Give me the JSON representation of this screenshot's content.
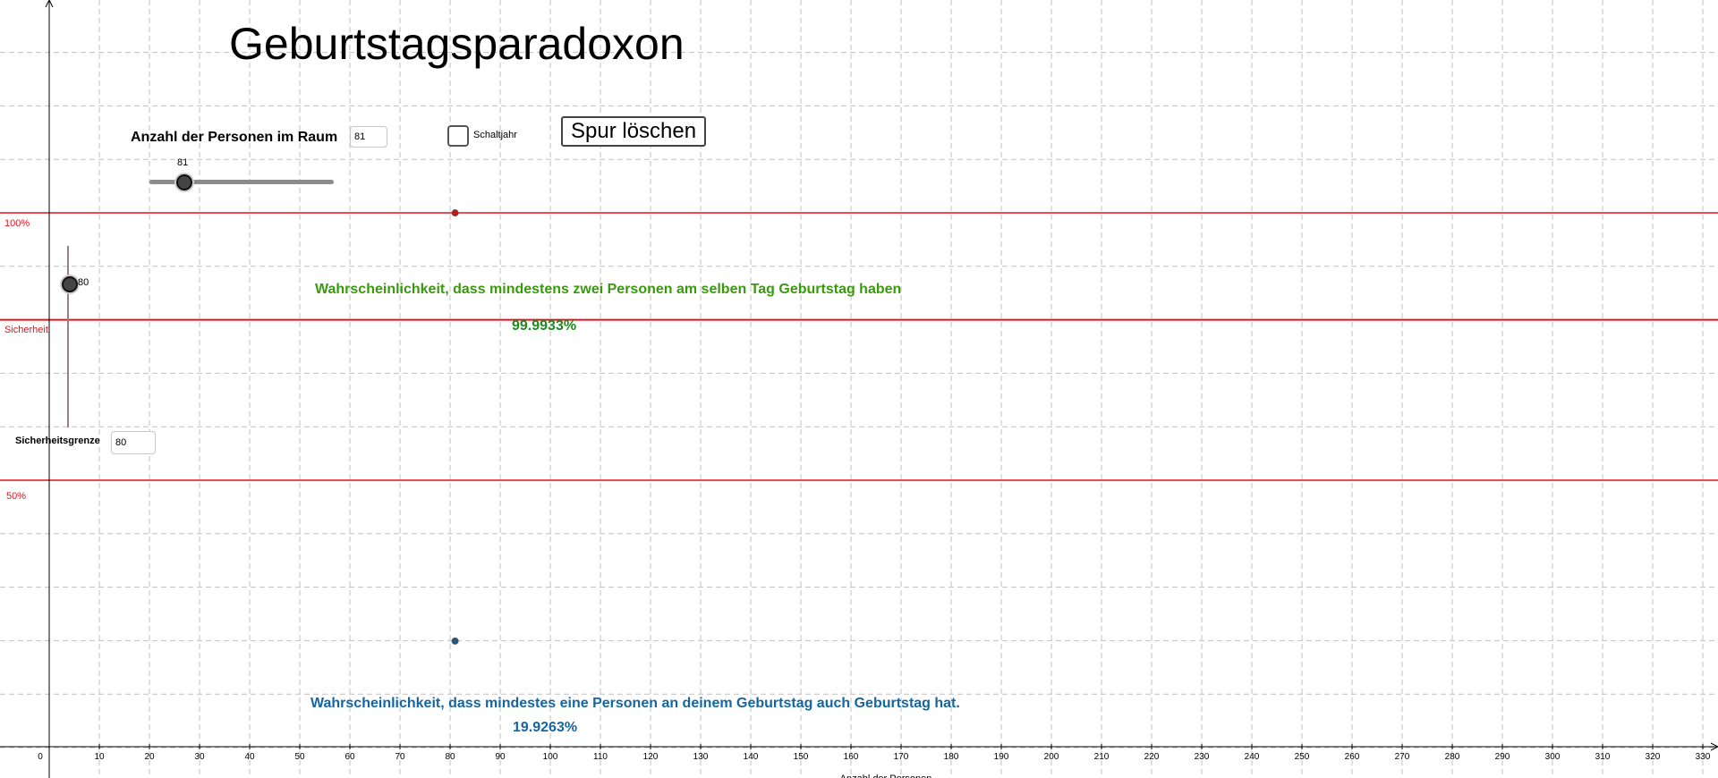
{
  "title": "Geburtstagsparadoxon",
  "persons": {
    "label": "Anzahl der Personen im Raum",
    "input_value": "81",
    "slider_value": "81",
    "slider_min": 0,
    "slider_max": 100,
    "slider_level": 81
  },
  "leap_year": {
    "label": "Schaltjahr",
    "checked": false
  },
  "clear_trace_button": "Spur löschen",
  "levels": {
    "hundred_label": "100%",
    "safety_label": "Sicherheit",
    "fifty_label": "50%"
  },
  "safety_slider": {
    "value": "80",
    "level": 80
  },
  "safety_limit": {
    "label": "Sicherheitsgrenze",
    "input_value": "80"
  },
  "prob_same_day": {
    "text": "Wahrscheinlichkeit, dass mindestens zwei Personen am selben Tag Geburtstag haben",
    "value": "99.9933%"
  },
  "prob_your_birthday": {
    "text": "Wahrscheinlichkeit, dass mindestes eine Personen an deinem Geburtstag auch Geburtstag hat.",
    "value": "19.9263%"
  },
  "axis": {
    "xlabel": "Anzahl der Personen",
    "ticks": [
      "0",
      "10",
      "20",
      "30",
      "40",
      "50",
      "60",
      "70",
      "80",
      "90",
      "100",
      "110",
      "120",
      "130",
      "140",
      "150",
      "160",
      "170",
      "180",
      "190",
      "200",
      "210",
      "220",
      "230",
      "240",
      "250",
      "260",
      "270",
      "280",
      "290",
      "300",
      "310",
      "320",
      "330"
    ]
  },
  "points": {
    "same_day": {
      "x": 81,
      "y": 99.9933
    },
    "your_birthday": {
      "x": 81,
      "y": 19.9263
    }
  },
  "colors": {
    "grid": "#c0c0c0",
    "red_line": "#e0141e",
    "green": "#3a9a0e",
    "blue": "#1566a0",
    "point_red": "#cc1111",
    "point_blue": "#1a5a8a"
  }
}
